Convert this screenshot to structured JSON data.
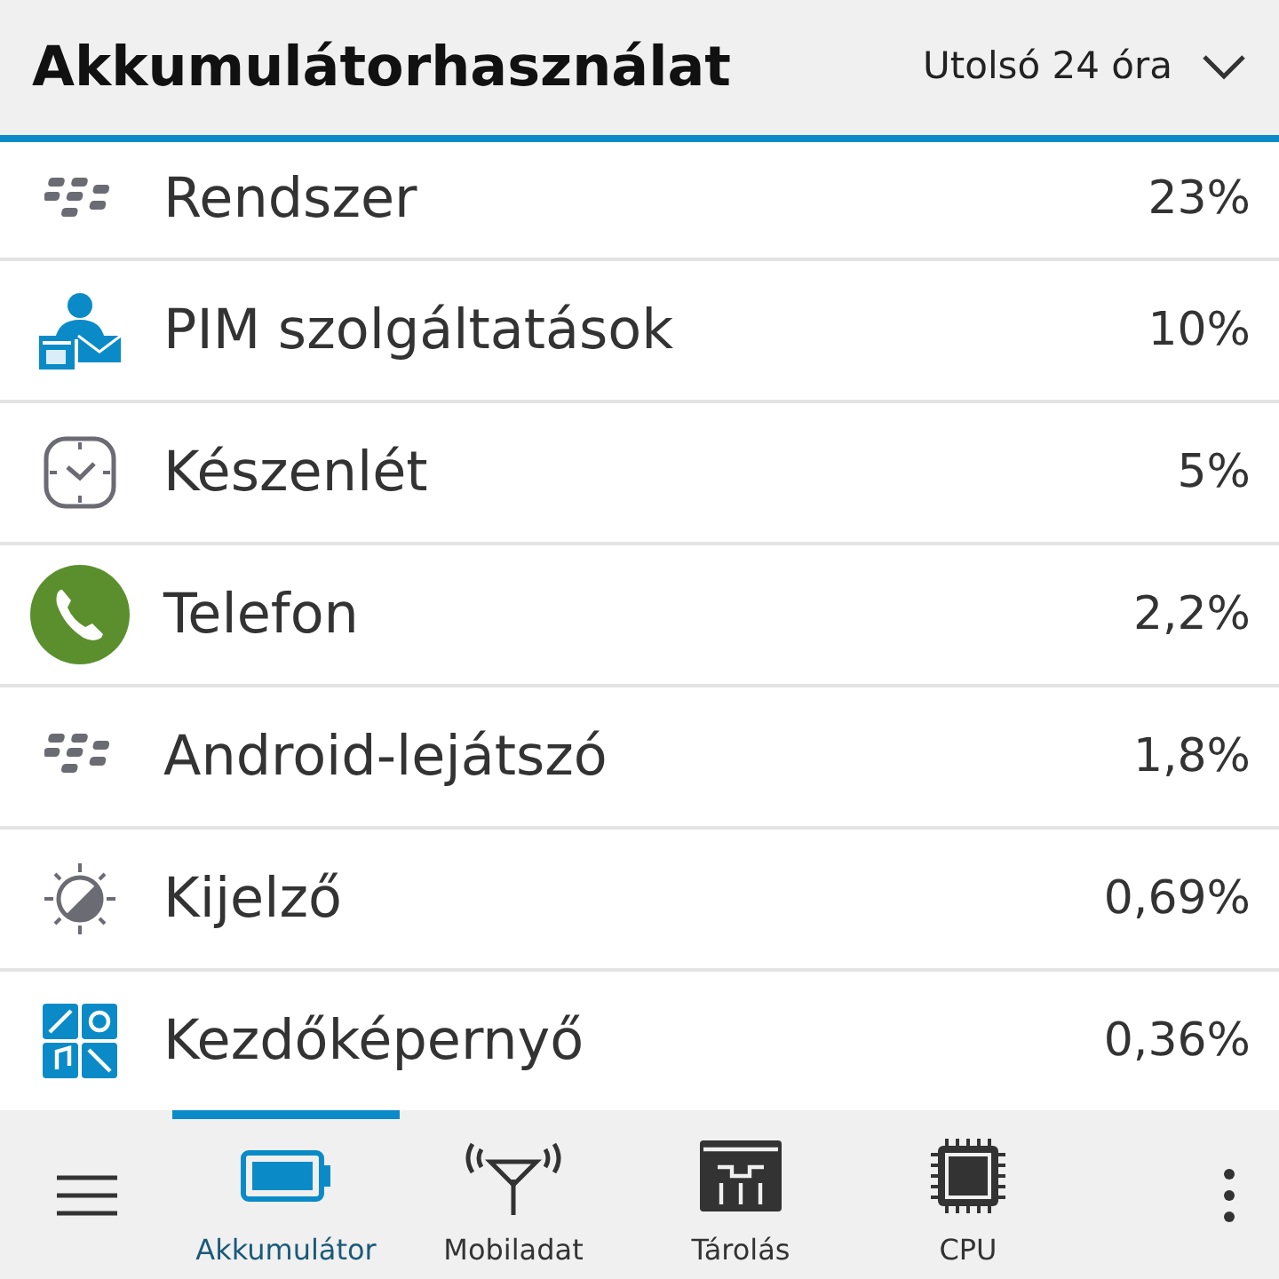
{
  "header": {
    "title": "Akkumulátorhasználat",
    "period": "Utolsó 24 óra"
  },
  "items": [
    {
      "name": "Rendszer",
      "usage": "23%"
    },
    {
      "name": "PIM szolgáltatások",
      "usage": "10%"
    },
    {
      "name": "Készenlét",
      "usage": "5%"
    },
    {
      "name": "Telefon",
      "usage": "2,2%"
    },
    {
      "name": "Android-lejátszó",
      "usage": "1,8%"
    },
    {
      "name": "Kijelző",
      "usage": "0,69%"
    },
    {
      "name": "Kezdőképernyő",
      "usage": "0,36%"
    }
  ],
  "tabs": [
    {
      "label": "Akkumulátor",
      "selected": true
    },
    {
      "label": "Mobiladat",
      "selected": false
    },
    {
      "label": "Tárolás",
      "selected": false
    },
    {
      "label": "CPU",
      "selected": false
    }
  ]
}
